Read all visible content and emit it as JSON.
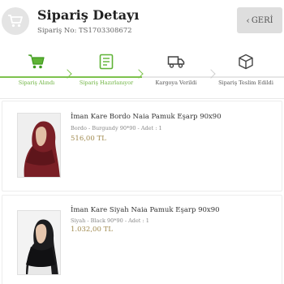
{
  "header": {
    "title": "Sipariş Detayı",
    "order_no": "Sipariş No: TS1703308672",
    "back_label": "GERİ",
    "icon": "shopping-cart-icon"
  },
  "colors": {
    "accent_green": "#7ec24e",
    "price_gold": "#a08a4f",
    "pending_gray": "#e6e6e6"
  },
  "steps": [
    {
      "label": "Sipariş Alındı",
      "icon": "cart-icon",
      "state": "done"
    },
    {
      "label": "Sipariş Hazırlanıyor",
      "icon": "list-icon",
      "state": "done"
    },
    {
      "label": "Kargoya Verildi",
      "icon": "truck-icon",
      "state": "pending"
    },
    {
      "label": "Sipariş Teslim Edildi",
      "icon": "box-icon",
      "state": "pending"
    }
  ],
  "items": [
    {
      "name": "İman Kare Bordo Naia Pamuk Eşarp 90x90",
      "variant": "Bordo - Burgundy 90*90 - Adet : 1",
      "price": "516,00 TL",
      "image": "burgundy-scarf-model"
    },
    {
      "name": "İman Kare Siyah Naia Pamuk Eşarp 90x90",
      "variant": "Siyah - Black 90*90 - Adet : 1",
      "price": "1.032,00 TL",
      "image": "black-scarf-model"
    }
  ]
}
